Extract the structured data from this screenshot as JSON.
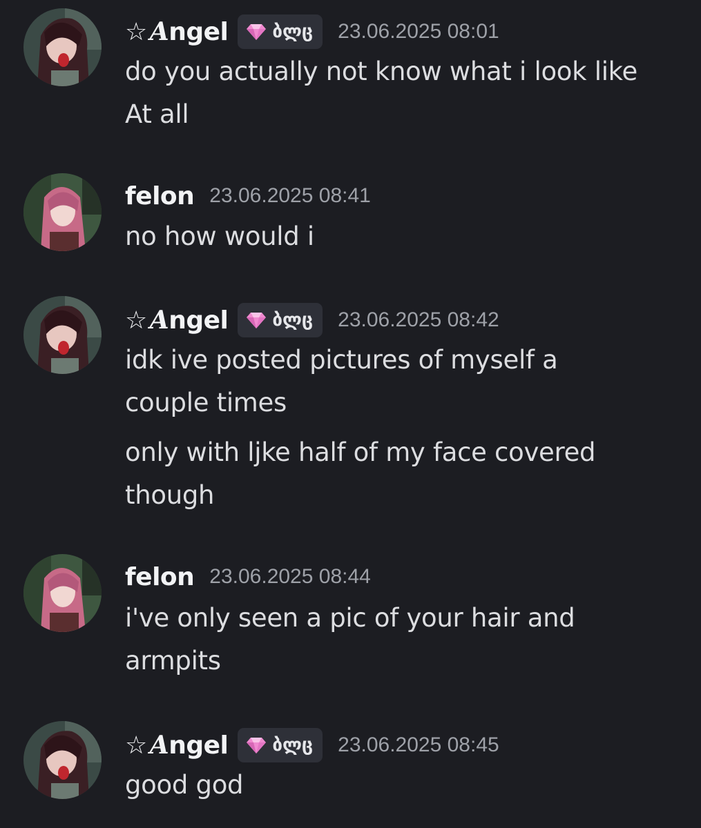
{
  "messages": [
    {
      "author": {
        "star": "☆",
        "initial": "A",
        "rest": "ngel"
      },
      "tag": {
        "icon": "gem-icon",
        "text": "ბლც"
      },
      "timestamp": "23.06.2025 08:01",
      "lines": [
        "do you actually not know what i look like",
        "At all"
      ]
    },
    {
      "author": {
        "name": "felon"
      },
      "timestamp": "23.06.2025 08:41",
      "lines": [
        "no how would i"
      ]
    },
    {
      "author": {
        "star": "☆",
        "initial": "A",
        "rest": "ngel"
      },
      "tag": {
        "icon": "gem-icon",
        "text": "ბლც"
      },
      "timestamp": "23.06.2025 08:42",
      "lines": [
        "idk ive posted pictures of myself a",
        "couple times",
        "only with ljke half of my face covered",
        "though"
      ]
    },
    {
      "author": {
        "name": "felon"
      },
      "timestamp": "23.06.2025 08:44",
      "lines": [
        "i've only seen a pic of your hair and",
        "armpits"
      ]
    },
    {
      "author": {
        "star": "☆",
        "initial": "A",
        "rest": "ngel"
      },
      "tag": {
        "icon": "gem-icon",
        "text": "ბლც"
      },
      "timestamp": "23.06.2025 08:45",
      "lines": [
        "good god"
      ]
    }
  ],
  "colors": {
    "background": "#1c1d22",
    "username": "#f2f3f5",
    "timestamp": "#9ea1a8",
    "message_text": "#dcdde0",
    "tag_background": "#2e3038",
    "gem": "#f08ad0"
  }
}
